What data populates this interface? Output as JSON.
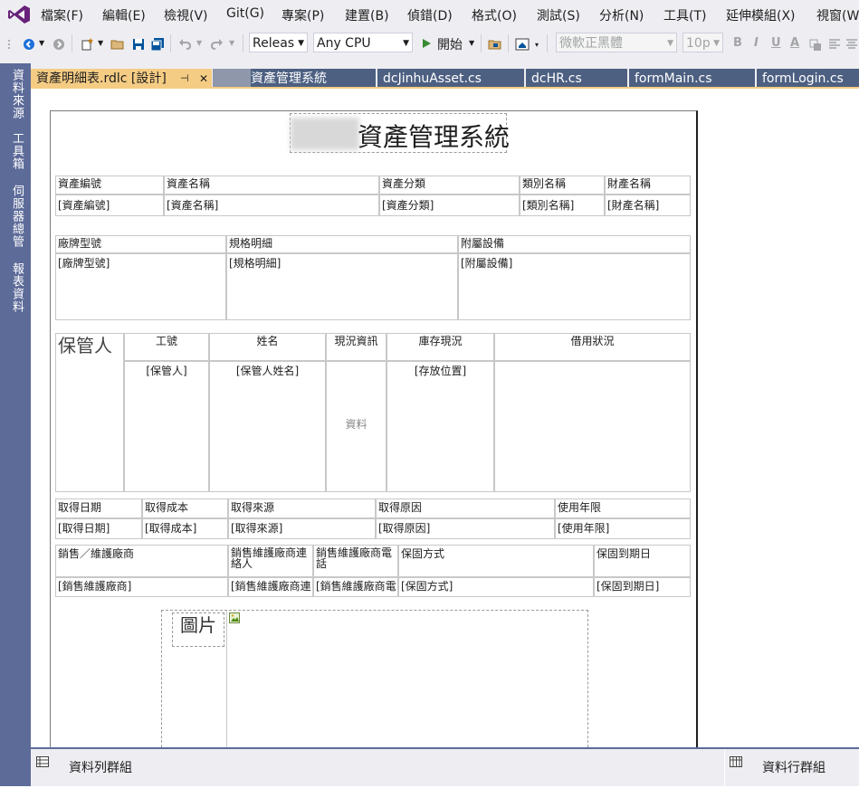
{
  "menu": {
    "items": [
      "檔案(F)",
      "編輯(E)",
      "檢視(V)",
      "Git(G)",
      "專案(P)",
      "建置(B)",
      "偵錯(D)",
      "格式(O)",
      "測試(S)",
      "分析(N)",
      "工具(T)",
      "延伸模組(X)",
      "視窗(W"
    ]
  },
  "toolbar": {
    "config": "Releas",
    "platform": "Any CPU",
    "start_label": "開始",
    "font_name": "微軟正黑體",
    "font_size": "10p",
    "bold": "B",
    "italic": "I",
    "underline": "U",
    "fontcolor": "A"
  },
  "left_panel": {
    "tabs": [
      "資料來源",
      "工具箱",
      "伺服器總管",
      "報表資料"
    ]
  },
  "tabs": {
    "active_label": "資產明細表.rdlc [設計]",
    "pin": "⊣",
    "close": "✕",
    "items": [
      "資產管理系統",
      "dcJinhuAsset.cs",
      "dcHR.cs",
      "formMain.cs",
      "formLogin.cs"
    ]
  },
  "report": {
    "title": "資產管理系統",
    "table1": {
      "headers": [
        "資產編號",
        "資產名稱",
        "資產分類",
        "類別名稱",
        "財產名稱"
      ],
      "fields": [
        "[資產編號]",
        "[資產名稱]",
        "[資產分類]",
        "[類別名稱]",
        "[財產名稱]"
      ]
    },
    "table2": {
      "headers": [
        "廠牌型號",
        "規格明細",
        "附屬設備"
      ],
      "fields": [
        "[廠牌型號]",
        "[規格明細]",
        "[附屬設備]"
      ]
    },
    "table3": {
      "big_label": "保管人",
      "headers": [
        "工號",
        "姓名",
        "現況資訊",
        "庫存現況",
        "借用狀況"
      ],
      "fields": [
        "[保管人]",
        "[保管人姓名]",
        "資料",
        "[存放位置]"
      ]
    },
    "table4": {
      "headers": [
        "取得日期",
        "取得成本",
        "取得來源",
        "取得原因",
        "使用年限"
      ],
      "fields": [
        "[取得日期]",
        "[取得成本]",
        "[取得來源]",
        "[取得原因]",
        "[使用年限]"
      ]
    },
    "table5": {
      "headers": [
        "銷售／維護廠商",
        "銷售維護廠商連絡人",
        "銷售維護廠商電話",
        "保固方式",
        "保固到期日"
      ],
      "fields": [
        "[銷售維護廠商]",
        "[銷售維護廠商連",
        "[銷售維護廠商電",
        "[保固方式]",
        "[保固到期日]"
      ]
    },
    "image_label": "圖片"
  },
  "bottom": {
    "row_groups": "資料列群組",
    "column_groups": "資料行群組"
  },
  "colors": {
    "menu_bg": "#eeeef2",
    "panel_bg": "#5d6b99",
    "active_tab": "#f5cc84",
    "inactive_tab": "#4d6082",
    "vs_purple": "#68217a"
  }
}
